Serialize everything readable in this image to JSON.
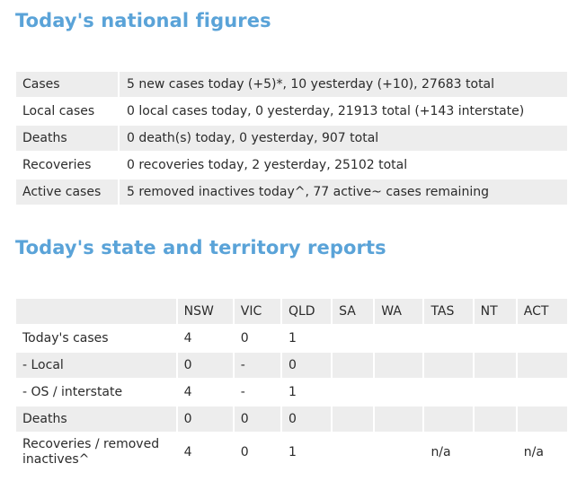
{
  "national": {
    "heading": "Today's national figures",
    "rows": [
      {
        "label": "Cases",
        "value": "5 new cases today (+5)*, 10 yesterday (+10), 27683 total"
      },
      {
        "label": "Local cases",
        "value": "0 local cases today, 0 yesterday, 21913 total (+143 interstate)"
      },
      {
        "label": "Deaths",
        "value": "0 death(s) today, 0 yesterday, 907 total"
      },
      {
        "label": "Recoveries",
        "value": "0 recoveries today, 2 yesterday, 25102 total"
      },
      {
        "label": "Active cases",
        "value": "5 removed inactives today^, 77 active~ cases remaining"
      }
    ]
  },
  "states": {
    "heading": "Today's state and territory reports",
    "columns": [
      "NSW",
      "VIC",
      "QLD",
      "SA",
      "WA",
      "TAS",
      "NT",
      "ACT"
    ],
    "rows": [
      {
        "label": "Today's cases",
        "values": [
          "4",
          "0",
          "1",
          "",
          "",
          "",
          "",
          ""
        ]
      },
      {
        "label": "- Local",
        "values": [
          "0",
          "-",
          "0",
          "",
          "",
          "",
          "",
          ""
        ]
      },
      {
        "label": "- OS / interstate",
        "values": [
          "4",
          "-",
          "1",
          "",
          "",
          "",
          "",
          ""
        ]
      },
      {
        "label": "Deaths",
        "values": [
          "0",
          "0",
          "0",
          "",
          "",
          "",
          "",
          ""
        ]
      },
      {
        "label": "Recoveries / removed inactives^",
        "values": [
          "4",
          "0",
          "1",
          "",
          "",
          "n/a",
          "",
          "n/a"
        ]
      }
    ]
  }
}
